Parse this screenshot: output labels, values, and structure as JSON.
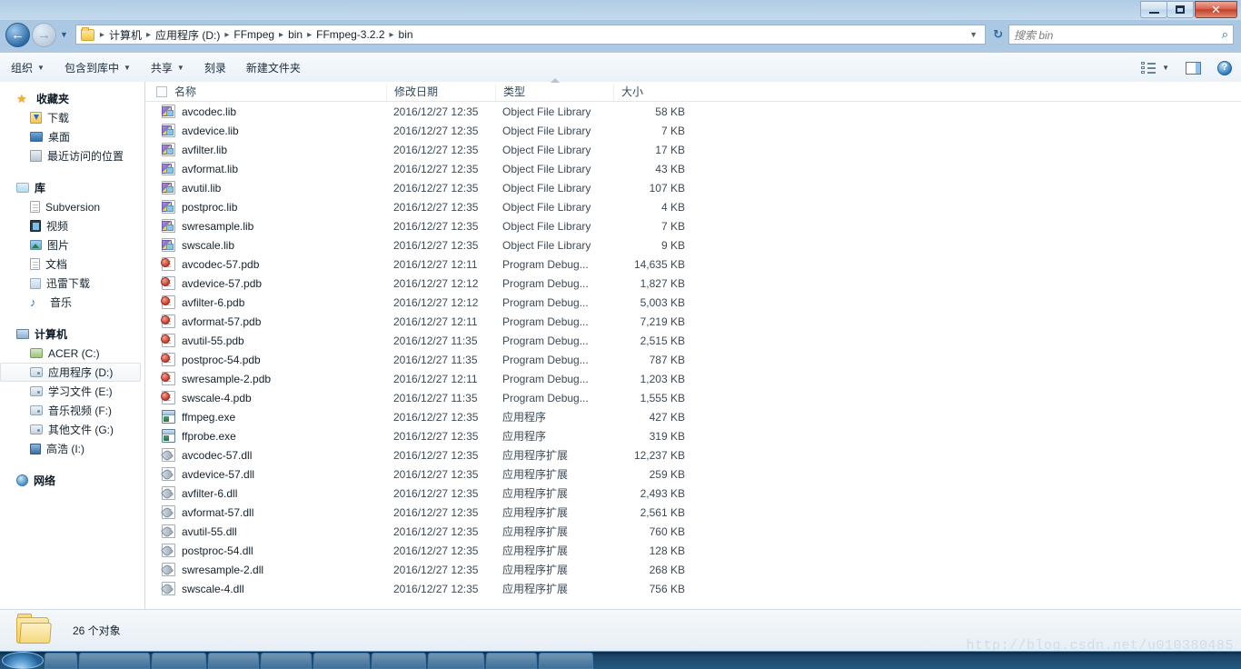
{
  "window": {
    "controls": {
      "minimize": "–",
      "maximize": "❐",
      "close": "✕"
    }
  },
  "addressbar": {
    "back_label": "←",
    "forward_label": "→",
    "history_caret": "▼",
    "dropdown_caret": "▼",
    "refresh_label": "↻",
    "folder_icon": "folder-icon",
    "crumbs": [
      "计算机",
      "应用程序 (D:)",
      "FFmpeg",
      "bin",
      "FFmpeg-3.2.2",
      "bin"
    ],
    "separator": "▸"
  },
  "search": {
    "placeholder": "搜索 bin",
    "icon": "search-icon",
    "glyph": "⌕"
  },
  "toolbar": {
    "items": [
      {
        "label": "组织",
        "caret": "▼"
      },
      {
        "label": "包含到库中",
        "caret": "▼"
      },
      {
        "label": "共享",
        "caret": "▼"
      },
      {
        "label": "刻录",
        "caret": ""
      },
      {
        "label": "新建文件夹",
        "caret": ""
      }
    ],
    "view_caret": "▼",
    "help_glyph": "?"
  },
  "sidebar": {
    "groups": [
      {
        "name": "favorites",
        "head": {
          "label": "收藏夹",
          "icon": "star-icon"
        },
        "items": [
          {
            "label": "下载",
            "icon": "downloads-icon"
          },
          {
            "label": "桌面",
            "icon": "desktop-icon"
          },
          {
            "label": "最近访问的位置",
            "icon": "recent-places-icon"
          }
        ]
      },
      {
        "name": "libraries",
        "head": {
          "label": "库",
          "icon": "library-icon"
        },
        "items": [
          {
            "label": "Subversion",
            "icon": "document-icon"
          },
          {
            "label": "视频",
            "icon": "video-icon"
          },
          {
            "label": "图片",
            "icon": "pictures-icon"
          },
          {
            "label": "文档",
            "icon": "documents-icon"
          },
          {
            "label": "迅雷下载",
            "icon": "thunder-download-icon"
          },
          {
            "label": "音乐",
            "icon": "music-icon"
          }
        ]
      },
      {
        "name": "computer",
        "head": {
          "label": "计算机",
          "icon": "computer-icon"
        },
        "items": [
          {
            "label": "ACER (C:)",
            "icon": "system-drive-icon",
            "selected": false
          },
          {
            "label": "应用程序 (D:)",
            "icon": "hard-drive-icon",
            "selected": true
          },
          {
            "label": "学习文件 (E:)",
            "icon": "hard-drive-icon",
            "selected": false
          },
          {
            "label": "音乐视频 (F:)",
            "icon": "hard-drive-icon",
            "selected": false
          },
          {
            "label": "其他文件 (G:)",
            "icon": "hard-drive-icon",
            "selected": false
          },
          {
            "label": "高浩 (I:)",
            "icon": "user-drive-icon",
            "selected": false
          }
        ]
      },
      {
        "name": "network",
        "head": {
          "label": "网络",
          "icon": "network-icon"
        },
        "items": []
      }
    ]
  },
  "filelist": {
    "columns": [
      {
        "key": "name",
        "label": "名称"
      },
      {
        "key": "date",
        "label": "修改日期"
      },
      {
        "key": "type",
        "label": "类型"
      },
      {
        "key": "size",
        "label": "大小"
      }
    ],
    "sort": {
      "column": "类型",
      "direction": "ascending"
    },
    "rows": [
      {
        "name": "avcodec.lib",
        "date": "2016/12/27 12:35",
        "type": "Object File Library",
        "size": "58 KB",
        "icon": "lib-file-icon"
      },
      {
        "name": "avdevice.lib",
        "date": "2016/12/27 12:35",
        "type": "Object File Library",
        "size": "7 KB",
        "icon": "lib-file-icon"
      },
      {
        "name": "avfilter.lib",
        "date": "2016/12/27 12:35",
        "type": "Object File Library",
        "size": "17 KB",
        "icon": "lib-file-icon"
      },
      {
        "name": "avformat.lib",
        "date": "2016/12/27 12:35",
        "type": "Object File Library",
        "size": "43 KB",
        "icon": "lib-file-icon"
      },
      {
        "name": "avutil.lib",
        "date": "2016/12/27 12:35",
        "type": "Object File Library",
        "size": "107 KB",
        "icon": "lib-file-icon"
      },
      {
        "name": "postproc.lib",
        "date": "2016/12/27 12:35",
        "type": "Object File Library",
        "size": "4 KB",
        "icon": "lib-file-icon"
      },
      {
        "name": "swresample.lib",
        "date": "2016/12/27 12:35",
        "type": "Object File Library",
        "size": "7 KB",
        "icon": "lib-file-icon"
      },
      {
        "name": "swscale.lib",
        "date": "2016/12/27 12:35",
        "type": "Object File Library",
        "size": "9 KB",
        "icon": "lib-file-icon"
      },
      {
        "name": "avcodec-57.pdb",
        "date": "2016/12/27 12:11",
        "type": "Program Debug...",
        "size": "14,635 KB",
        "icon": "pdb-file-icon"
      },
      {
        "name": "avdevice-57.pdb",
        "date": "2016/12/27 12:12",
        "type": "Program Debug...",
        "size": "1,827 KB",
        "icon": "pdb-file-icon"
      },
      {
        "name": "avfilter-6.pdb",
        "date": "2016/12/27 12:12",
        "type": "Program Debug...",
        "size": "5,003 KB",
        "icon": "pdb-file-icon"
      },
      {
        "name": "avformat-57.pdb",
        "date": "2016/12/27 12:11",
        "type": "Program Debug...",
        "size": "7,219 KB",
        "icon": "pdb-file-icon"
      },
      {
        "name": "avutil-55.pdb",
        "date": "2016/12/27 11:35",
        "type": "Program Debug...",
        "size": "2,515 KB",
        "icon": "pdb-file-icon"
      },
      {
        "name": "postproc-54.pdb",
        "date": "2016/12/27 11:35",
        "type": "Program Debug...",
        "size": "787 KB",
        "icon": "pdb-file-icon"
      },
      {
        "name": "swresample-2.pdb",
        "date": "2016/12/27 12:11",
        "type": "Program Debug...",
        "size": "1,203 KB",
        "icon": "pdb-file-icon"
      },
      {
        "name": "swscale-4.pdb",
        "date": "2016/12/27 11:35",
        "type": "Program Debug...",
        "size": "1,555 KB",
        "icon": "pdb-file-icon"
      },
      {
        "name": "ffmpeg.exe",
        "date": "2016/12/27 12:35",
        "type": "应用程序",
        "size": "427 KB",
        "icon": "exe-file-icon"
      },
      {
        "name": "ffprobe.exe",
        "date": "2016/12/27 12:35",
        "type": "应用程序",
        "size": "319 KB",
        "icon": "exe-file-icon"
      },
      {
        "name": "avcodec-57.dll",
        "date": "2016/12/27 12:35",
        "type": "应用程序扩展",
        "size": "12,237 KB",
        "icon": "dll-file-icon"
      },
      {
        "name": "avdevice-57.dll",
        "date": "2016/12/27 12:35",
        "type": "应用程序扩展",
        "size": "259 KB",
        "icon": "dll-file-icon"
      },
      {
        "name": "avfilter-6.dll",
        "date": "2016/12/27 12:35",
        "type": "应用程序扩展",
        "size": "2,493 KB",
        "icon": "dll-file-icon"
      },
      {
        "name": "avformat-57.dll",
        "date": "2016/12/27 12:35",
        "type": "应用程序扩展",
        "size": "2,561 KB",
        "icon": "dll-file-icon"
      },
      {
        "name": "avutil-55.dll",
        "date": "2016/12/27 12:35",
        "type": "应用程序扩展",
        "size": "760 KB",
        "icon": "dll-file-icon"
      },
      {
        "name": "postproc-54.dll",
        "date": "2016/12/27 12:35",
        "type": "应用程序扩展",
        "size": "128 KB",
        "icon": "dll-file-icon"
      },
      {
        "name": "swresample-2.dll",
        "date": "2016/12/27 12:35",
        "type": "应用程序扩展",
        "size": "268 KB",
        "icon": "dll-file-icon"
      },
      {
        "name": "swscale-4.dll",
        "date": "2016/12/27 12:35",
        "type": "应用程序扩展",
        "size": "756 KB",
        "icon": "dll-file-icon"
      }
    ]
  },
  "statusbar": {
    "text": "26 个对象",
    "icon": "folder-icon"
  },
  "watermark": {
    "text": "http://blog.csdn.net/u010380485"
  },
  "colors": {
    "accent": "#2f6ea8",
    "titlebar": "#bcd4ea",
    "close_button": "#c1412c",
    "selection": "#eaf4fd"
  }
}
